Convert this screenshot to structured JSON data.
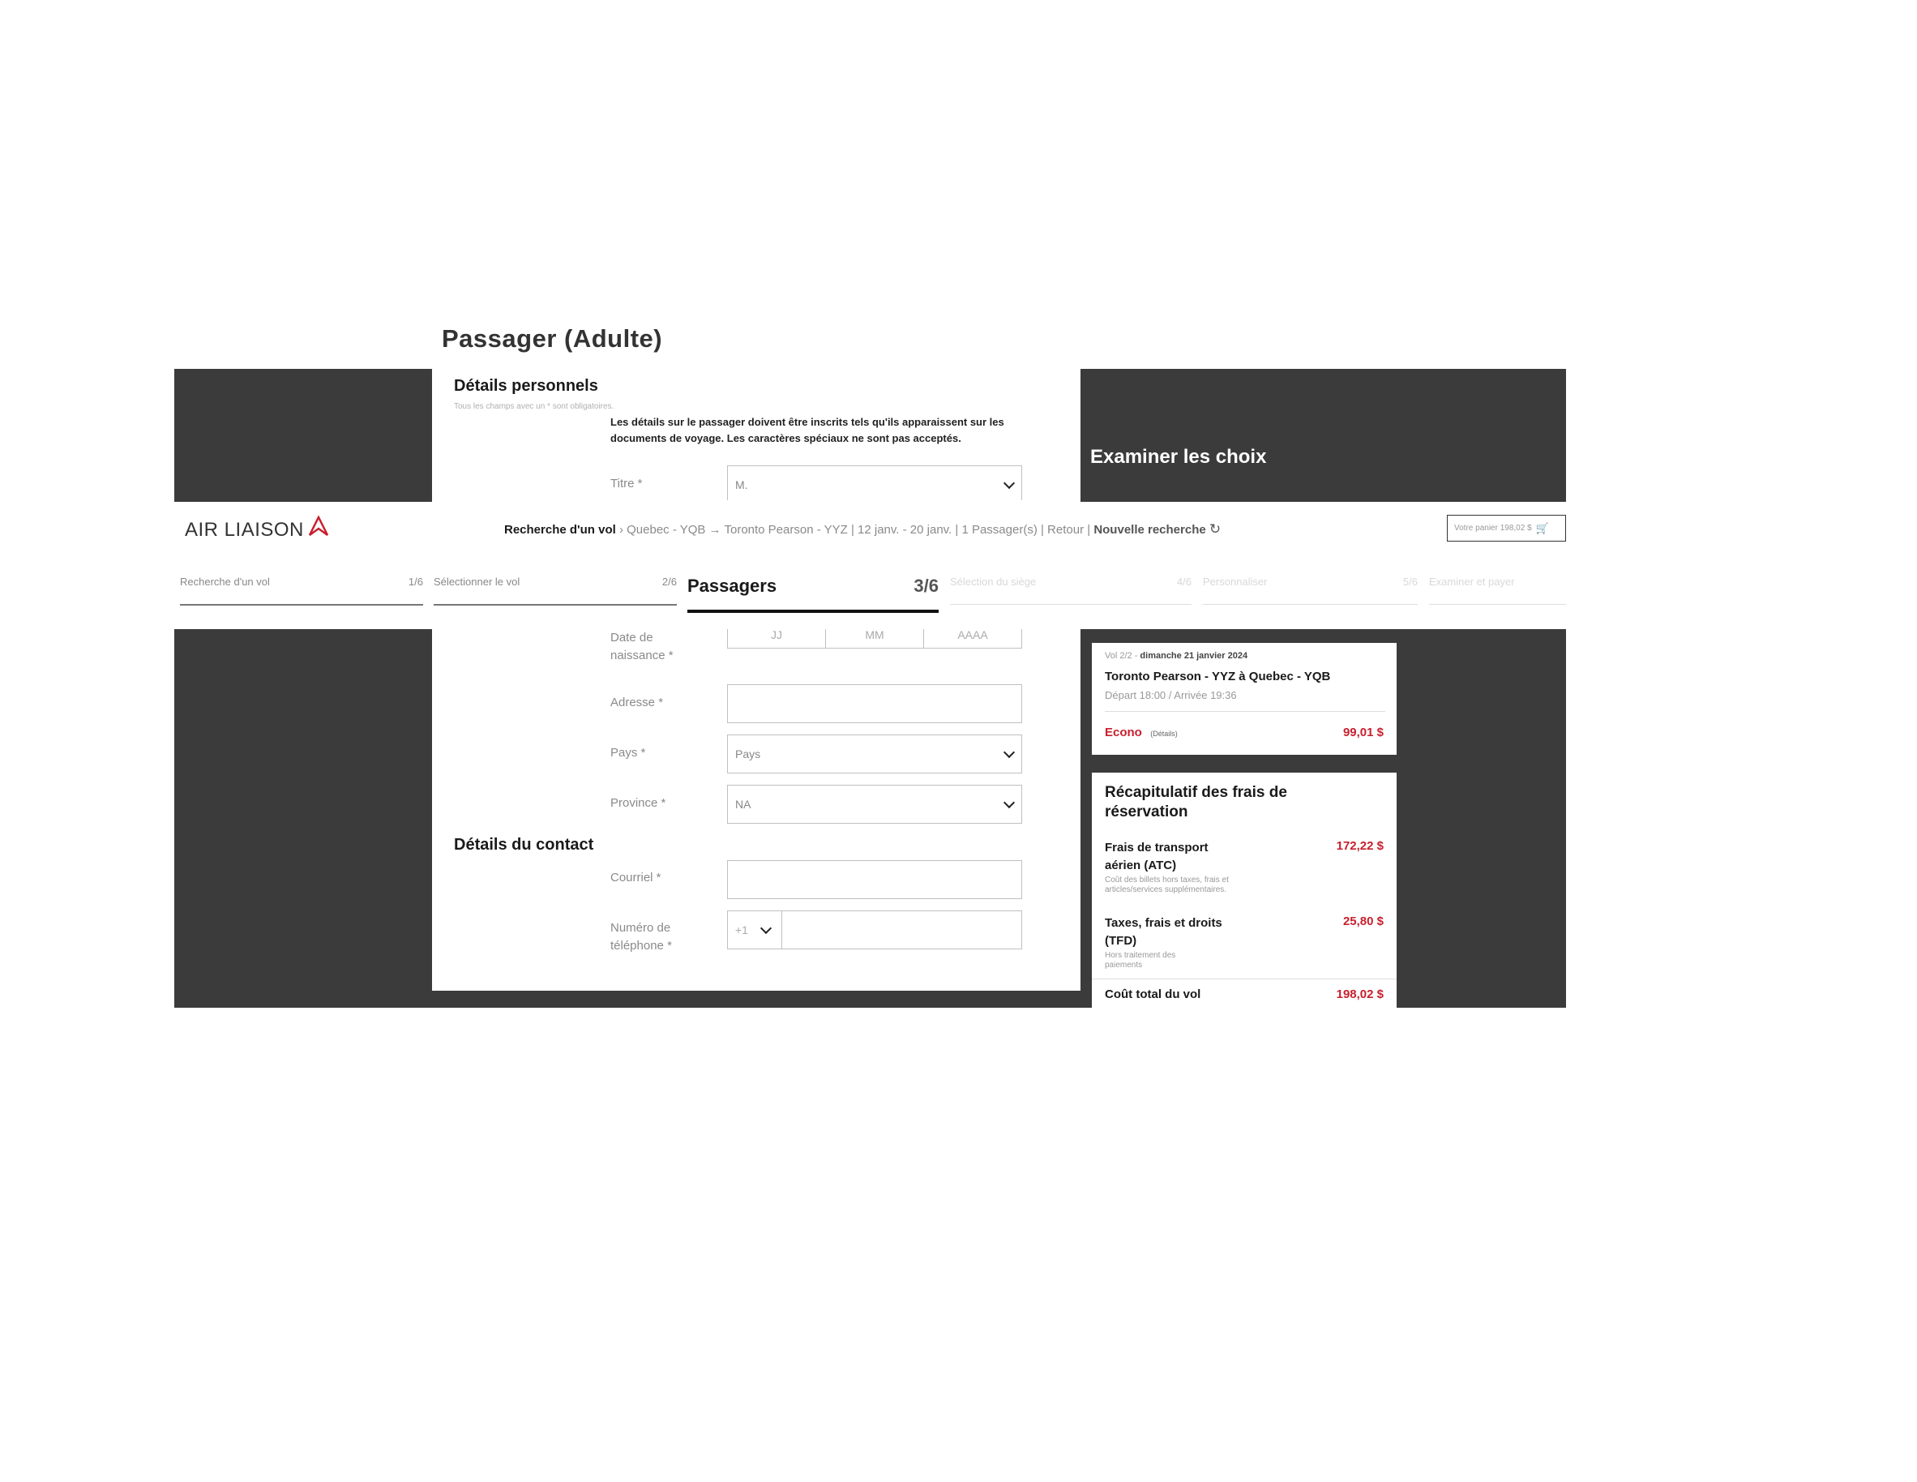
{
  "page": {
    "title": "Passager (Adulte)",
    "review_title": "Examiner les choix"
  },
  "header": {
    "logo": "AIR LIAISON",
    "breadcrumb": {
      "label": "Recherche d'un vol",
      "origin": "Quebec - YQB",
      "destination": "Toronto Pearson - YYZ",
      "details": "| 12 janv. - 20 janv. | 1 Passager(s) | Retour |",
      "new_search": "Nouvelle recherche"
    },
    "cart": "Votre panier 198,02 $"
  },
  "steps": [
    {
      "label": "Recherche d'un vol",
      "num": "1/6"
    },
    {
      "label": "Sélectionner le vol",
      "num": "2/6"
    },
    {
      "label": "Passagers",
      "num": "3/6"
    },
    {
      "label": "Sélection du siège",
      "num": "4/6"
    },
    {
      "label": "Personnaliser",
      "num": "5/6"
    },
    {
      "label": "Examiner et payer",
      "num": ""
    }
  ],
  "form": {
    "personal_title": "Détails personnels",
    "required_note": "Tous les champs avec un * sont obligatoires.",
    "warning": "Les détails sur le passager doivent être inscrits tels qu'ils apparaissent sur les documents de voyage. Les caractères spéciaux ne sont pas acceptés.",
    "title_label": "Titre *",
    "title_value": "M.",
    "dob_label": "Date de naissance *",
    "dob_dd": "JJ",
    "dob_mm": "MM",
    "dob_yyyy": "AAAA",
    "address_label": "Adresse *",
    "country_label": "Pays *",
    "country_value": "Pays",
    "province_label": "Province *",
    "province_value": "NA",
    "contact_title": "Détails du contact",
    "email_label": "Courriel *",
    "phone_label": "Numéro de téléphone *",
    "phone_code": "+1"
  },
  "flight": {
    "leg_prefix": "Vol 2/2 - ",
    "date": "dimanche 21 janvier 2024",
    "route": "Toronto Pearson - YYZ à Quebec - YQB",
    "times": "Départ 18:00 / Arrivée 19:36",
    "fare": "Econo",
    "details_link": "(Détails)",
    "price": "99,01 $"
  },
  "fees": {
    "title": "Récapitulatif des frais de réservation",
    "atc_label": "Frais de transport aérien (ATC)",
    "atc_note": "Coût des billets hors taxes, frais et articles/services supplémentaires.",
    "atc_value": "172,22 $",
    "tfd_label": "Taxes, frais et droits (TFD)",
    "tfd_note": "Hors traitement des paiements",
    "tfd_value": "25,80 $",
    "total_label": "Coût total du vol",
    "total_value": "198,02 $"
  },
  "colors": {
    "accent_red": "#c8202e",
    "dark_bg": "#3b3b3b"
  }
}
